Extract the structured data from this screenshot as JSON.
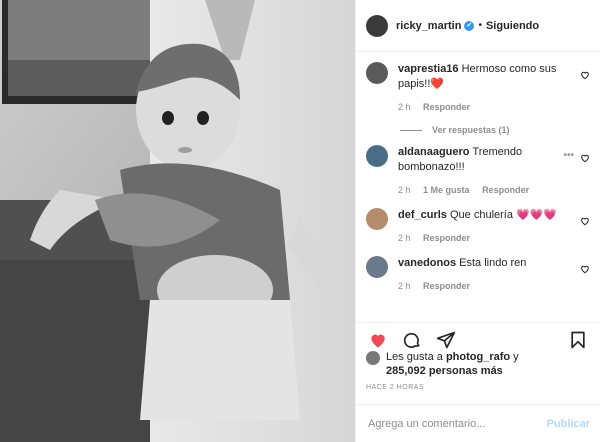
{
  "post": {
    "author": "ricky_martin",
    "follow_status": "Siguiendo",
    "dot": "•",
    "verified_mark": "✔"
  },
  "comments": [
    {
      "user": "vaprestia16",
      "text": "Hermoso como sus papis!!❤️",
      "time": "2 h",
      "likes": "",
      "reply": "Responder",
      "replies": "Ver respuestas (1)"
    },
    {
      "user": "aldanaaguero",
      "text": "Tremendo bombonazo!!!",
      "time": "2 h",
      "likes": "1 Me gusta",
      "reply": "Responder",
      "replies": ""
    },
    {
      "user": "def_curls",
      "text": "Que chulería 💗💗💗",
      "time": "2 h",
      "likes": "",
      "reply": "Responder",
      "replies": ""
    },
    {
      "user": "vanedonos",
      "text": "Esta lindo ren",
      "time": "2 h",
      "likes": "",
      "reply": "Responder",
      "replies": ""
    }
  ],
  "likes": {
    "prefix": "Les gusta a",
    "user": "photog_rafo",
    "connector": "y",
    "count": "285,092 personas más"
  },
  "timestamp": "HACE 2 HORAS",
  "add_comment": {
    "placeholder": "Agrega un comentario...",
    "publish": "Publicar"
  },
  "icons": {
    "like": "heart-filled-icon",
    "comment": "comment-icon",
    "share": "share-icon",
    "save": "bookmark-icon",
    "comment_like": "heart-outline-icon",
    "more": "more-icon"
  },
  "colors": {
    "like_red": "#ed4956",
    "verified_blue": "#3897f0",
    "publish_disabled": "#b3dbff"
  }
}
